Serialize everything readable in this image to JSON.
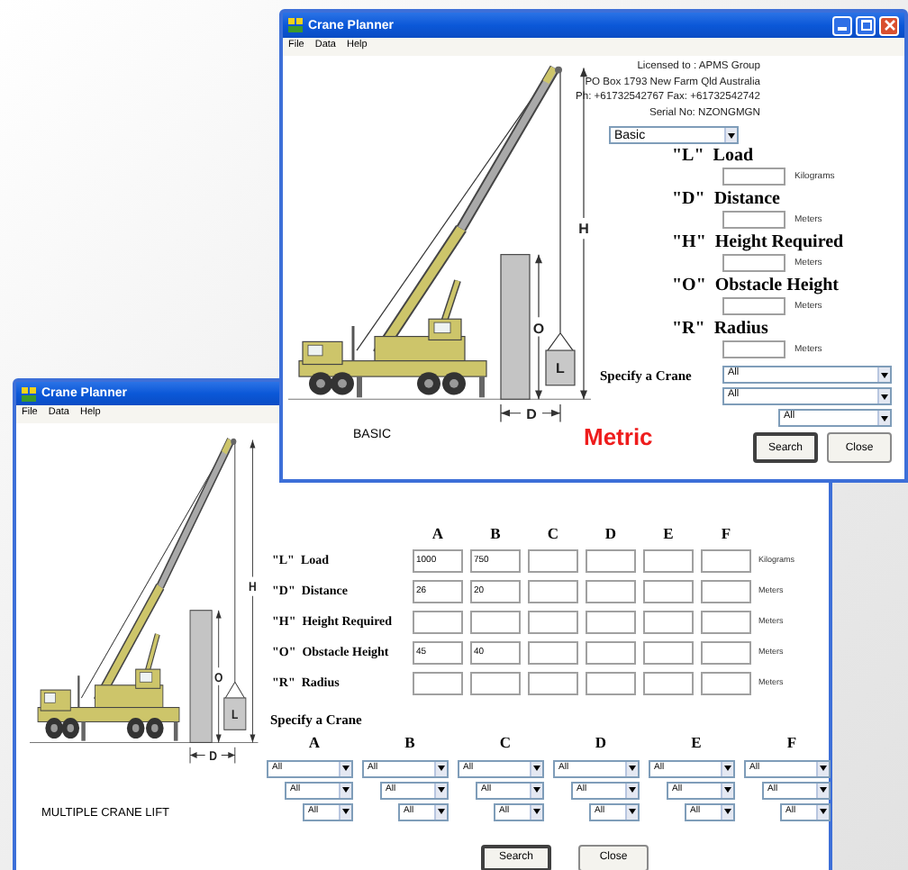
{
  "back_window": {
    "title": "Crane Planner",
    "menu": [
      "File",
      "Data",
      "Help"
    ],
    "diagram": {
      "height": "H",
      "obstacle": "O",
      "load": "L",
      "distance": "D",
      "caption": "MULTIPLE CRANE LIFT"
    },
    "columns": [
      "A",
      "B",
      "C",
      "D",
      "E",
      "F"
    ],
    "rows": [
      {
        "code": "\"L\"",
        "label": "Load",
        "unit": "Kilograms",
        "cells": [
          {
            "value": "1000"
          },
          {
            "value": "750"
          },
          {},
          {},
          {},
          {}
        ]
      },
      {
        "code": "\"D\"",
        "label": "Distance",
        "unit": "Meters",
        "cells": [
          {
            "value": "26"
          },
          {
            "value": "20"
          },
          {},
          {},
          {},
          {}
        ]
      },
      {
        "code": "\"H\"",
        "label": "Height Required",
        "unit": "Meters",
        "cells": [
          {},
          {},
          {},
          {},
          {},
          {}
        ]
      },
      {
        "code": "\"O\"",
        "label": "Obstacle Height",
        "unit": "Meters",
        "cells": [
          {
            "value": "45"
          },
          {
            "value": "40"
          },
          {},
          {},
          {},
          {}
        ]
      },
      {
        "code": "\"R\"",
        "label": "Radius",
        "unit": "Meters",
        "cells": [
          {},
          {},
          {},
          {},
          {},
          {}
        ]
      }
    ],
    "specify_label": "Specify a Crane",
    "crane_columns": [
      {
        "label": "A",
        "selects": [
          "All",
          "All",
          "All"
        ]
      },
      {
        "label": "B",
        "selects": [
          "All",
          "All",
          "All"
        ]
      },
      {
        "label": "C",
        "selects": [
          "All",
          "All",
          "All"
        ]
      },
      {
        "label": "D",
        "selects": [
          "All",
          "All",
          "All"
        ]
      },
      {
        "label": "E",
        "selects": [
          "All",
          "All",
          "All"
        ]
      },
      {
        "label": "F",
        "selects": [
          "All",
          "All",
          "All"
        ]
      }
    ],
    "buttons": [
      {
        "label": "Search",
        "default": true
      },
      {
        "label": "Close",
        "default": false
      }
    ]
  },
  "front_window": {
    "title": "Crane Planner",
    "menu": [
      "File",
      "Data",
      "Help"
    ],
    "license": [
      "Licensed to : APMS Group",
      "PO Box 1793 New Farm Qld Australia",
      "Ph: +61732542767 Fax: +61732542742",
      "Serial No: NZONGMGN"
    ],
    "mode": "Basic",
    "fields": [
      {
        "code": "\"L\"",
        "label": "Load",
        "unit": "Kilograms"
      },
      {
        "code": "\"D\"",
        "label": "Distance",
        "unit": "Meters"
      },
      {
        "code": "\"H\"",
        "label": "Height Required",
        "unit": "Meters"
      },
      {
        "code": "\"O\"",
        "label": "Obstacle Height",
        "unit": "Meters"
      },
      {
        "code": "\"R\"",
        "label": "Radius",
        "unit": "Meters"
      }
    ],
    "diagram": {
      "height": "H",
      "obstacle": "O",
      "load": "L",
      "distance": "D",
      "caption": "BASIC"
    },
    "specify_label": "Specify a Crane",
    "crane_selects": [
      "All",
      "All",
      "All"
    ],
    "units": "Metric",
    "buttons": [
      {
        "label": "Search",
        "default": true
      },
      {
        "label": "Close",
        "default": false
      }
    ]
  }
}
